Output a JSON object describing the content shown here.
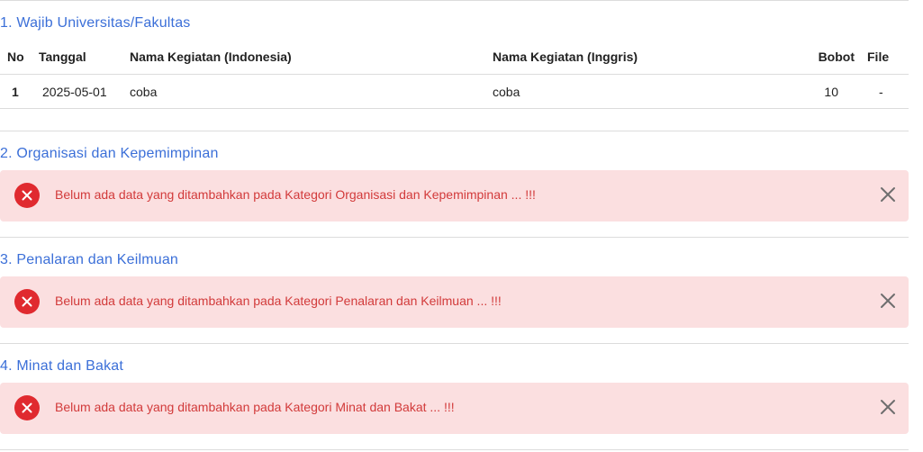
{
  "sections": [
    {
      "title": "1. Wajib Universitas/Fakultas",
      "table": {
        "headers": [
          "No",
          "Tanggal",
          "Nama Kegiatan (Indonesia)",
          "Nama Kegiatan (Inggris)",
          "Bobot",
          "File"
        ],
        "rows": [
          [
            "1",
            "2025-05-01",
            "coba",
            "coba",
            "10",
            "-"
          ]
        ]
      }
    },
    {
      "title": "2. Organisasi dan Kepemimpinan",
      "alert": "Belum ada data yang ditambahkan pada Kategori Organisasi dan Kepemimpinan ... !!!"
    },
    {
      "title": "3. Penalaran dan Keilmuan",
      "alert": "Belum ada data yang ditambahkan pada Kategori Penalaran dan Keilmuan ... !!!"
    },
    {
      "title": "4. Minat dan Bakat",
      "alert": "Belum ada data yang ditambahkan pada Kategori Minat dan Bakat ... !!!"
    }
  ],
  "colors": {
    "section_title": "#3b6fd8",
    "alert_bg": "#fbdfe0",
    "alert_text": "#d23a3a",
    "alert_icon": "#e02a2f",
    "divider": "#dcdcdc"
  },
  "icons": {
    "alert": "x-circle-icon",
    "close": "close-icon"
  }
}
